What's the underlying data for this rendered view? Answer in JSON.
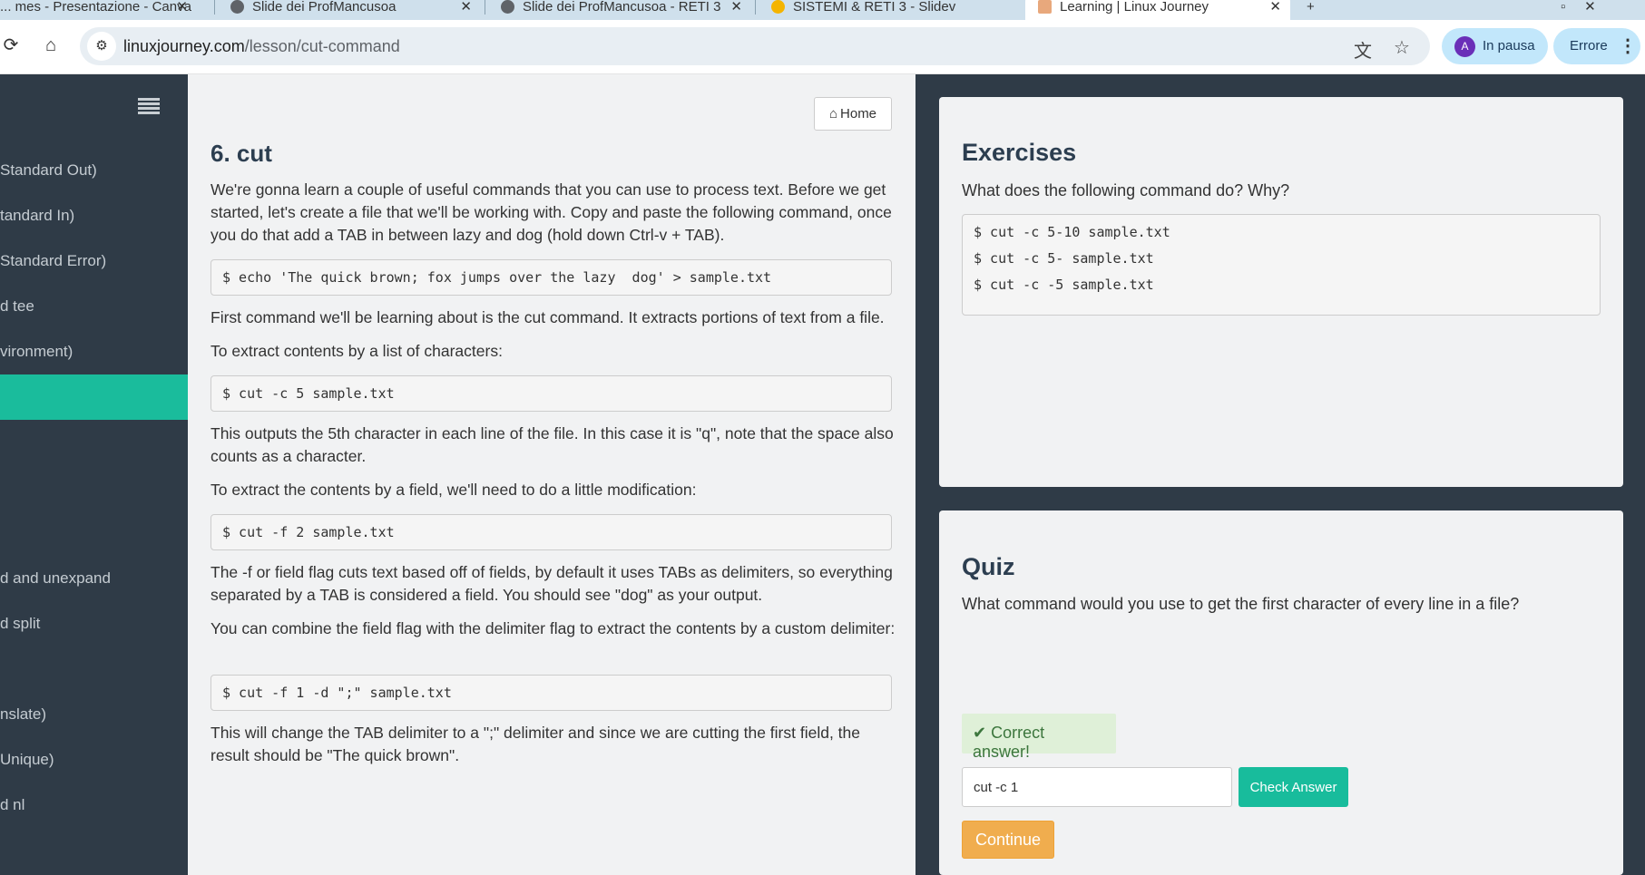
{
  "browser": {
    "tabs": [
      {
        "title": "... mes - Presentazione - Canva",
        "active": false
      },
      {
        "title": "Slide dei ProfMancusoa",
        "active": false
      },
      {
        "title": "Slide dei ProfMancusoa - RETI 3",
        "active": false
      },
      {
        "title": "SISTEMI & RETI 3 - Slidev",
        "active": false
      },
      {
        "title": "Learning | Linux Journey",
        "active": true
      }
    ],
    "url_domain": "linuxjourney.com",
    "url_path": "/lesson/cut-command",
    "profile_initial": "A",
    "profile_label": "In pausa",
    "error_label": "Errore"
  },
  "sidebar": {
    "items": [
      {
        "label": "Standard Out)"
      },
      {
        "label": "tandard In)"
      },
      {
        "label": "Standard Error)"
      },
      {
        "label": "d tee"
      },
      {
        "label": "vironment)"
      },
      {
        "label": ""
      },
      {
        "label": "d and unexpand"
      },
      {
        "label": "d split"
      },
      {
        "label": "nslate)"
      },
      {
        "label": "Unique)"
      },
      {
        "label": "d nl"
      }
    ]
  },
  "lesson": {
    "home_label": "Home",
    "title": "6. cut",
    "intro": "We're gonna learn a couple of useful commands that you can use to process text. Before we get started, let's create a file that we'll be working with. Copy and paste the following command, once you do that add a TAB in between lazy and dog (hold down Ctrl-v + TAB).",
    "code1": "$ echo 'The quick brown; fox jumps over the lazy  dog' > sample.txt",
    "p2": "First command we'll be learning about is the cut command. It extracts portions of text from a file.",
    "p3": "To extract contents by a list of characters:",
    "code2": "$ cut -c 5 sample.txt",
    "p4": "This outputs the 5th character in each line of the file. In this case it is \"q\", note that the space also counts as a character.",
    "p5": "To extract the contents by a field, we'll need to do a little modification:",
    "code3": "$ cut -f 2 sample.txt",
    "p6": "The -f or field flag cuts text based off of fields, by default it uses TABs as delimiters, so everything separated by a TAB is considered a field. You should see \"dog\" as your output.",
    "p7": "You can combine the field flag with the delimiter flag to extract the contents by a custom delimiter:",
    "code4": "$ cut -f 1 -d \";\" sample.txt",
    "p8": "This will change the TAB delimiter to a \";\" delimiter and since we are cutting the first field, the result should be \"The quick brown\"."
  },
  "exercises": {
    "title": "Exercises",
    "question": "What does the following command do? Why?",
    "commands": [
      "$ cut -c 5-10 sample.txt",
      "$ cut -c 5- sample.txt",
      "$ cut -c -5 sample.txt"
    ]
  },
  "quiz": {
    "title": "Quiz",
    "question": "What command would you use to get the first character of every line in a file?",
    "correct_message": "Correct answer!",
    "answer_value": "cut -c 1",
    "check_label": "Check Answer",
    "continue_label": "Continue"
  },
  "colors": {
    "sidebar_bg": "#2f3b47",
    "accent": "#1abc9c",
    "success_bg": "#dff0d8",
    "success_text": "#3c763d",
    "continue": "#f0ad4e"
  }
}
